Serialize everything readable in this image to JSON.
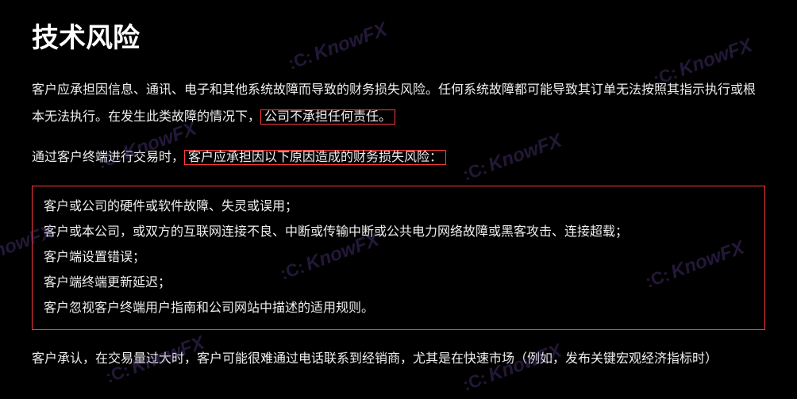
{
  "watermark": {
    "text": "KnowFX",
    "icon_label": "watermark-icon"
  },
  "heading": "技术风险",
  "para1_pre": "客户应承担因信息、通讯、电子和其他系统故障而导致的财务损失风险。任何系统故障都可能导致其订单无法按照其指示执行或根本无法执行。在发生此类故障的情况下，",
  "para1_highlight": "公司不承担任何责任。",
  "para2_pre": "通过客户终端进行交易时，",
  "para2_highlight": "客户应承担因以下原因造成的财务损失风险：",
  "list_items": [
    "客户或公司的硬件或软件故障、失灵或误用；",
    "客户或本公司，或双方的互联网连接不良、中断或传输中断或公共电力网络故障或黑客攻击、连接超载；",
    "客户端设置错误；",
    "客户端终端更新延迟；",
    "客户忽视客户终端用户指南和公司网站中描述的适用规则。"
  ],
  "para3": "客户承认，在交易量过大时，客户可能很难通过电话联系到经销商，尤其是在快速市场（例如，发布关键宏观经济指标时）"
}
